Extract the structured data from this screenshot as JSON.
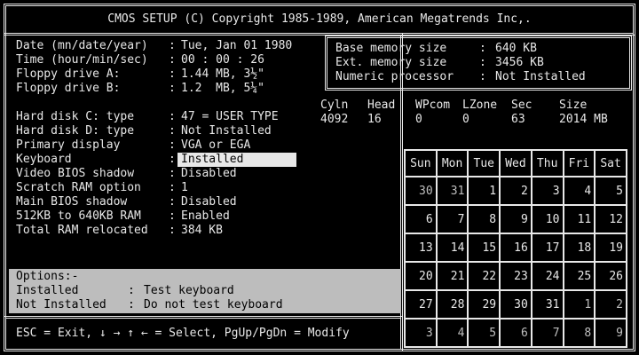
{
  "title": "CMOS SETUP (C) Copyright 1985-1989, American Megatrends Inc,.",
  "settings": [
    {
      "label": "Date (mn/date/year)",
      "value": "Tue, Jan 01 1980"
    },
    {
      "label": "Time (hour/min/sec)",
      "value": "00 : 00 : 26"
    },
    {
      "label": "Floppy drive A:",
      "value": "1.44 MB, 3½\""
    },
    {
      "label": "Floppy drive B:",
      "value": "1.2  MB, 5¼\""
    },
    {
      "label": "Hard disk C: type",
      "value": "47 = USER TYPE"
    },
    {
      "label": "Hard disk D: type",
      "value": "Not Installed"
    },
    {
      "label": "Primary display",
      "value": "VGA or EGA"
    },
    {
      "label": "Keyboard",
      "value": "Installed"
    },
    {
      "label": "Video BIOS shadow",
      "value": "Disabled"
    },
    {
      "label": "Scratch RAM option",
      "value": "1"
    },
    {
      "label": "Main BIOS shadow",
      "value": "Disabled"
    },
    {
      "label": "512KB to 640KB RAM",
      "value": "Enabled"
    },
    {
      "label": "Total RAM relocated",
      "value": "384 KB"
    }
  ],
  "memory": [
    {
      "label": "Base memory size",
      "value": "640 KB"
    },
    {
      "label": "Ext. memory size",
      "value": "3456 KB"
    },
    {
      "label": "Numeric processor",
      "value": "Not Installed"
    }
  ],
  "disk": {
    "headers": [
      "Cyln",
      "Head",
      "WPcom",
      "LZone",
      "Sec",
      "Size"
    ],
    "values": [
      "4092",
      "16",
      "0",
      "0",
      "63",
      "2014 MB"
    ]
  },
  "options": {
    "title": "Options:-",
    "items": [
      {
        "name": "Installed",
        "desc": "Test keyboard"
      },
      {
        "name": "Not Installed",
        "desc": "Do not test keyboard"
      }
    ]
  },
  "footer": "ESC = Exit, ↓ → ↑ ← = Select, PgUp/PgDn = Modify",
  "calendar": {
    "days": [
      "Sun",
      "Mon",
      "Tue",
      "Wed",
      "Thu",
      "Fri",
      "Sat"
    ],
    "weeks": [
      [
        "30",
        "31",
        "1",
        "2",
        "3",
        "4",
        "5"
      ],
      [
        "6",
        "7",
        "8",
        "9",
        "10",
        "11",
        "12"
      ],
      [
        "13",
        "14",
        "15",
        "16",
        "17",
        "18",
        "19"
      ],
      [
        "20",
        "21",
        "22",
        "23",
        "24",
        "25",
        "26"
      ],
      [
        "27",
        "28",
        "29",
        "30",
        "31",
        "1",
        "2"
      ],
      [
        "3",
        "4",
        "5",
        "6",
        "7",
        "8",
        "9"
      ]
    ]
  }
}
